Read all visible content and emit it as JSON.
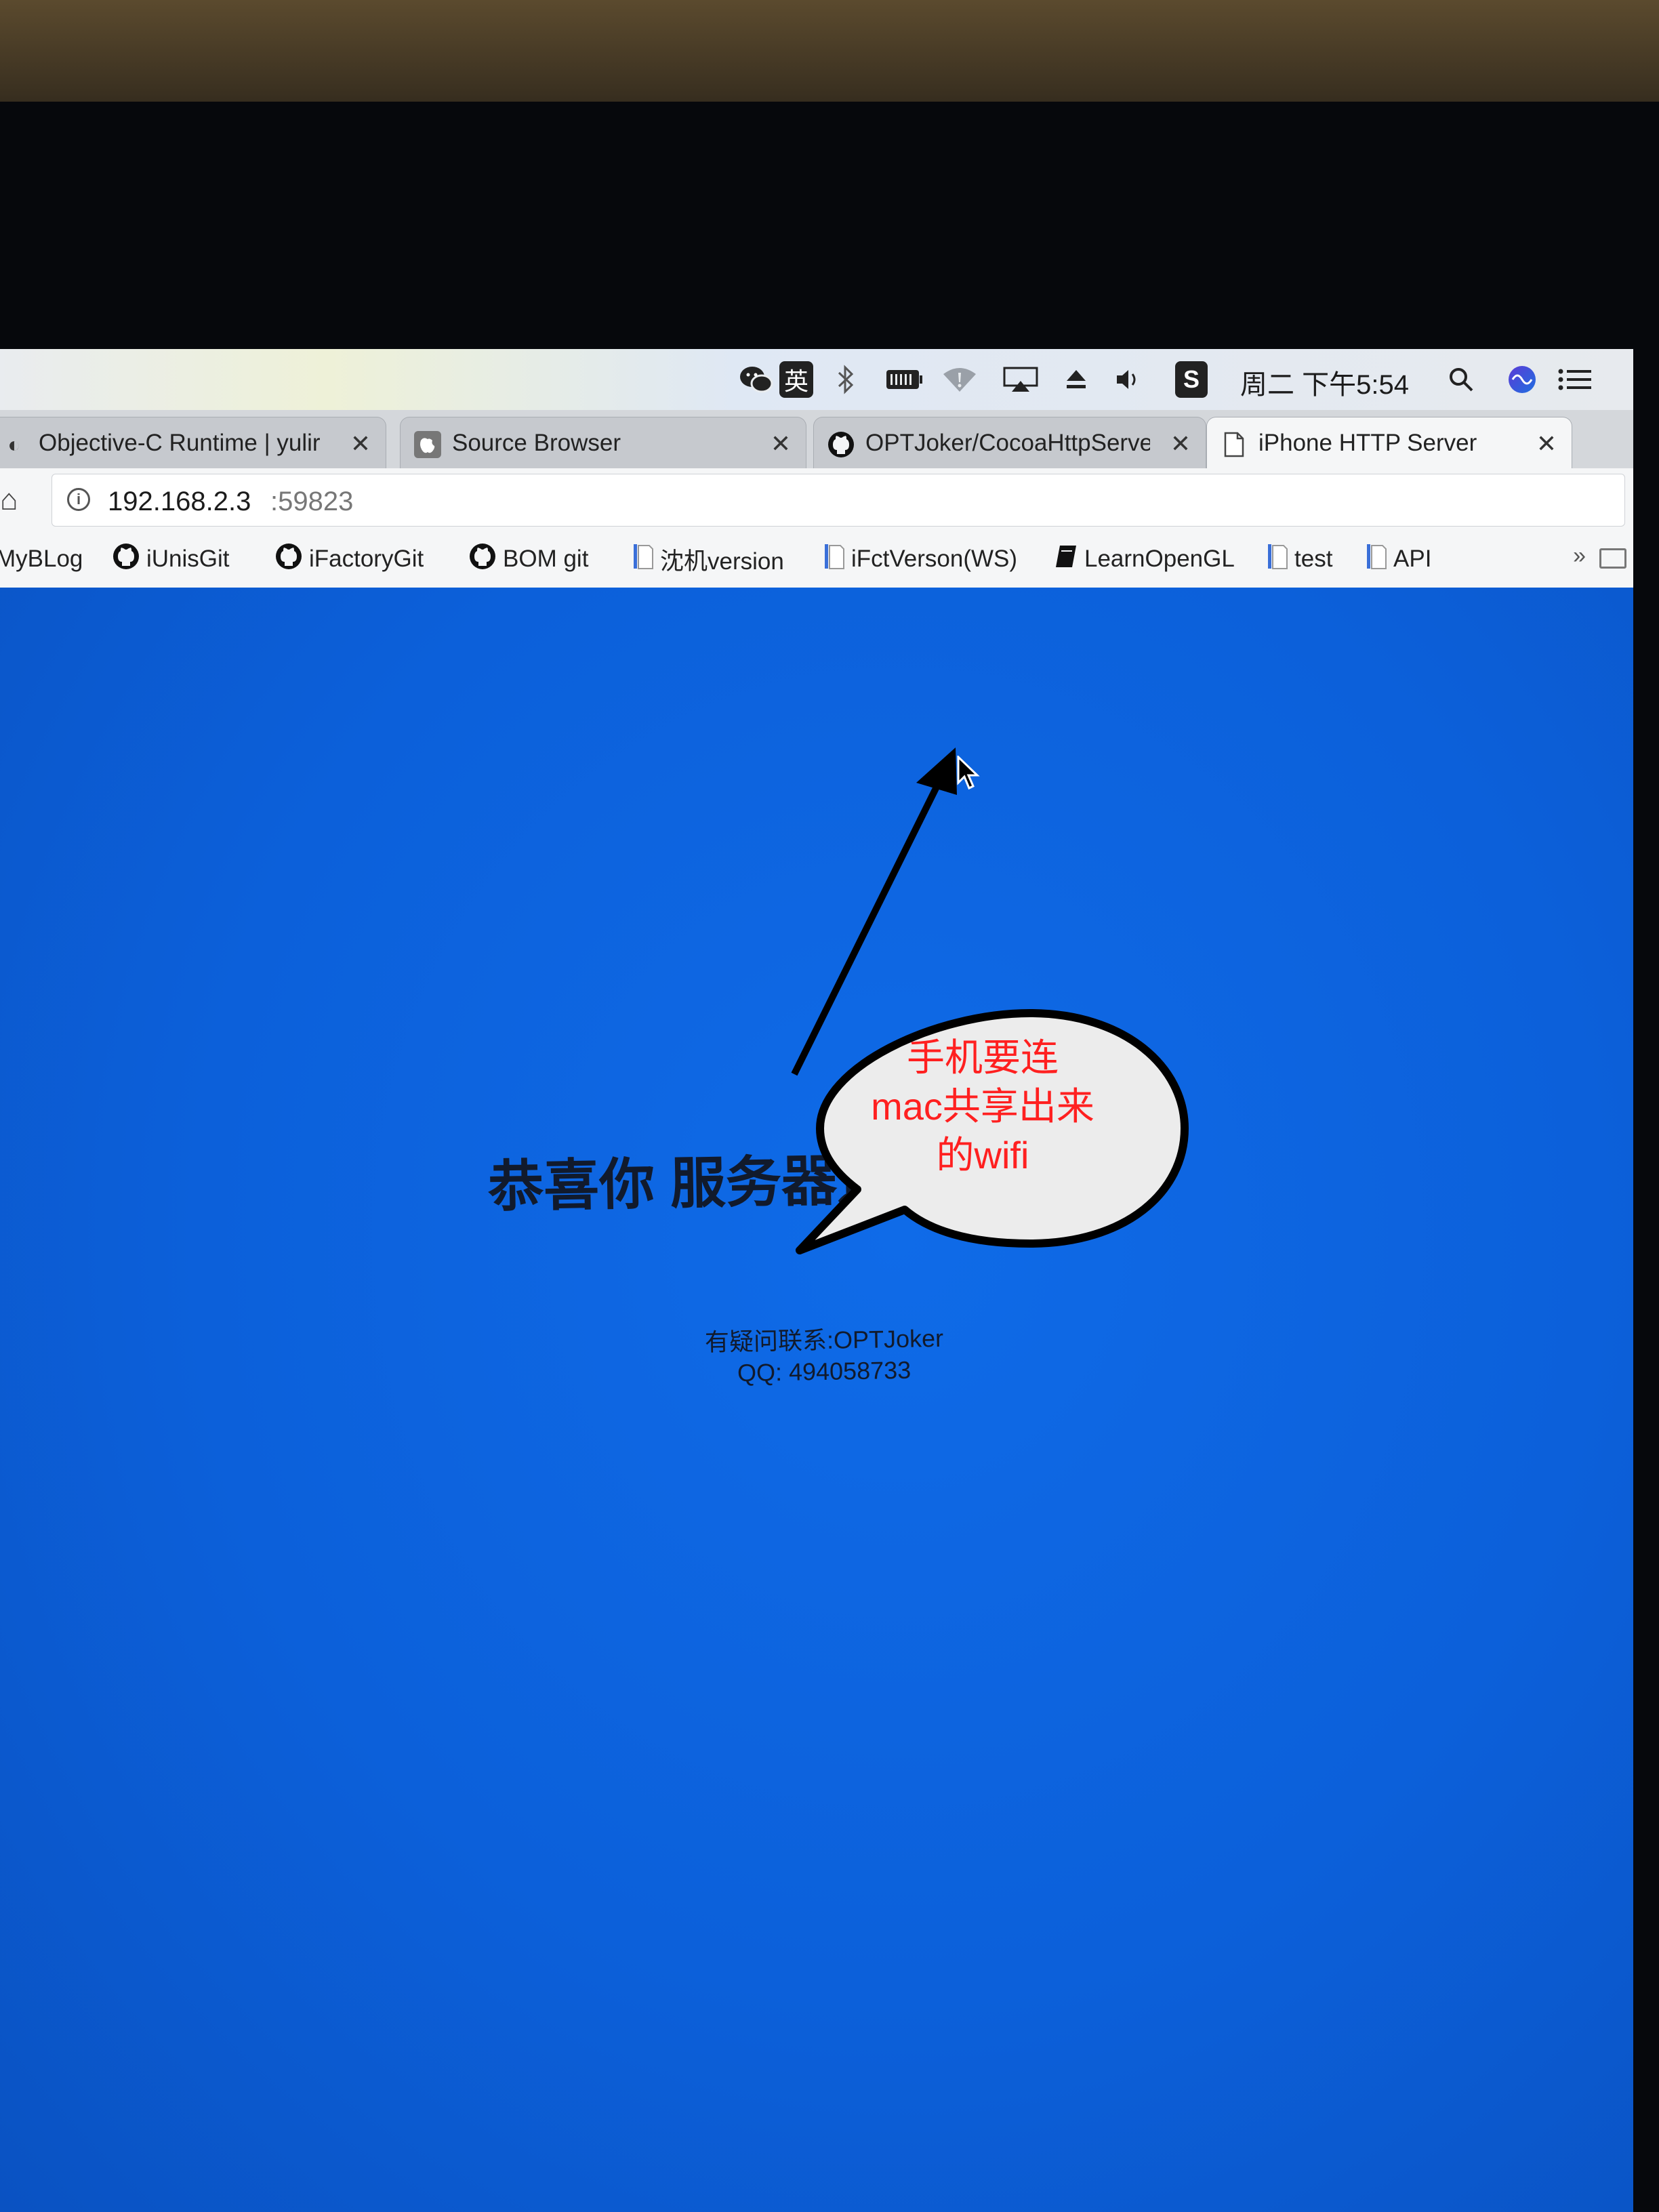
{
  "menubar": {
    "icons": [
      "wechat-icon",
      "ime-english-icon",
      "bluetooth-icon",
      "battery-icon",
      "wifi-sharing-icon",
      "airplay-icon",
      "eject-icon",
      "volume-icon",
      "sogou-input-icon",
      "spotlight-icon",
      "siri-icon",
      "notification-center-icon"
    ],
    "ime_label": "英",
    "sogou_label": "S",
    "clock": "周二 下午5:54"
  },
  "tabs": [
    {
      "label": "Objective-C Runtime | yulir",
      "icon": "blog-favicon",
      "active": false
    },
    {
      "label": "Source Browser",
      "icon": "apple-favicon",
      "active": false
    },
    {
      "label": "OPTJoker/CocoaHttpServe",
      "icon": "github-favicon",
      "active": false
    },
    {
      "label": "iPhone HTTP Server",
      "icon": "page-favicon",
      "active": true
    }
  ],
  "address_bar": {
    "host": "192.168.2.3",
    "port": ":59823"
  },
  "bookmarks": [
    {
      "label": "MyBLog",
      "icon": ""
    },
    {
      "label": "iUnisGit",
      "icon": "github-icon"
    },
    {
      "label": "iFactoryGit",
      "icon": "github-icon"
    },
    {
      "label": "BOM git",
      "icon": "github-icon"
    },
    {
      "label": "沈机version",
      "icon": "doc-icon"
    },
    {
      "label": "iFctVerson(WS)",
      "icon": "doc-icon"
    },
    {
      "label": "LearnOpenGL",
      "icon": "book-icon"
    },
    {
      "label": "test",
      "icon": "doc-icon"
    },
    {
      "label": "API",
      "icon": "doc-icon"
    }
  ],
  "bookmarks_more": "»",
  "page": {
    "headline": "恭喜你 服务器运行成功!",
    "contact": "有疑问联系:OPTJoker",
    "qq": "QQ: 494058733",
    "background_color": "#0e63e0"
  },
  "annotation": {
    "lines": [
      "手机要连",
      "mac共享出来",
      "的wifi"
    ],
    "text_color": "#ff2020"
  }
}
